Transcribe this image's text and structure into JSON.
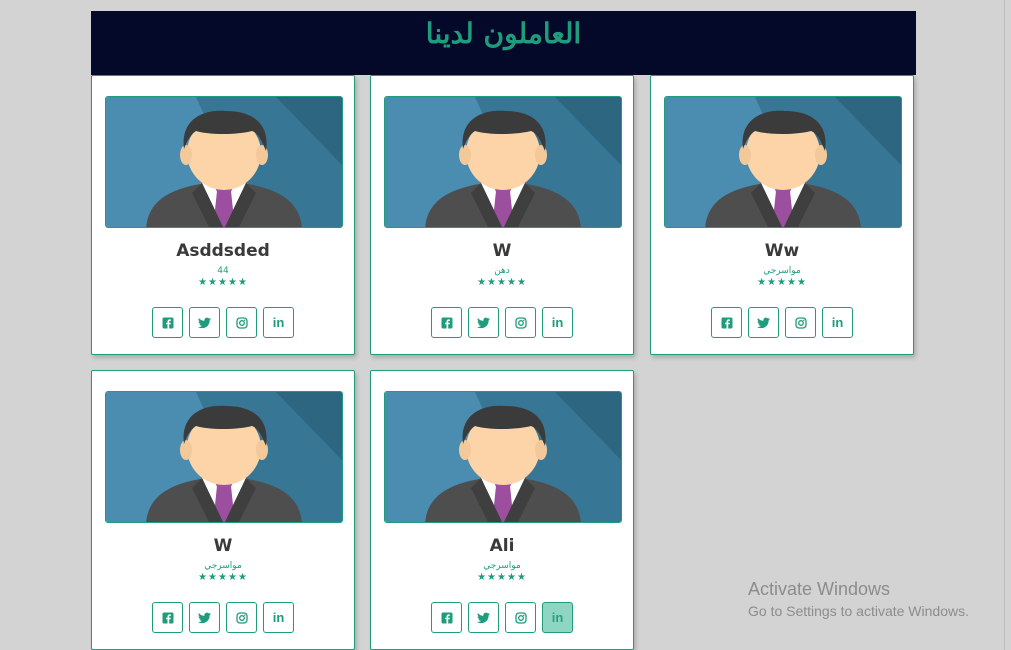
{
  "header": {
    "title": "العاملون لدينا"
  },
  "cards": [
    {
      "name": "Asddsded",
      "role": "44",
      "rating": "★★★★★"
    },
    {
      "name": "W",
      "role": "دهن",
      "rating": "★★★★★"
    },
    {
      "name": "Ww",
      "role": "مواسرجي",
      "rating": "★★★★★"
    },
    {
      "name": "W",
      "role": "مواسرجي",
      "rating": "★★★★★"
    },
    {
      "name": "Ali",
      "role": "مواسرجي",
      "rating": "★★★★★"
    }
  ],
  "social_icons": [
    "facebook-icon",
    "twitter-icon",
    "instagram-icon",
    "linkedin-icon"
  ],
  "colors": {
    "accent": "#1e9c7c",
    "header_bg": "#04092a",
    "page_bg": "#d3d3d3"
  },
  "watermark": {
    "line1": "Activate Windows",
    "line2": "Go to Settings to activate Windows."
  }
}
